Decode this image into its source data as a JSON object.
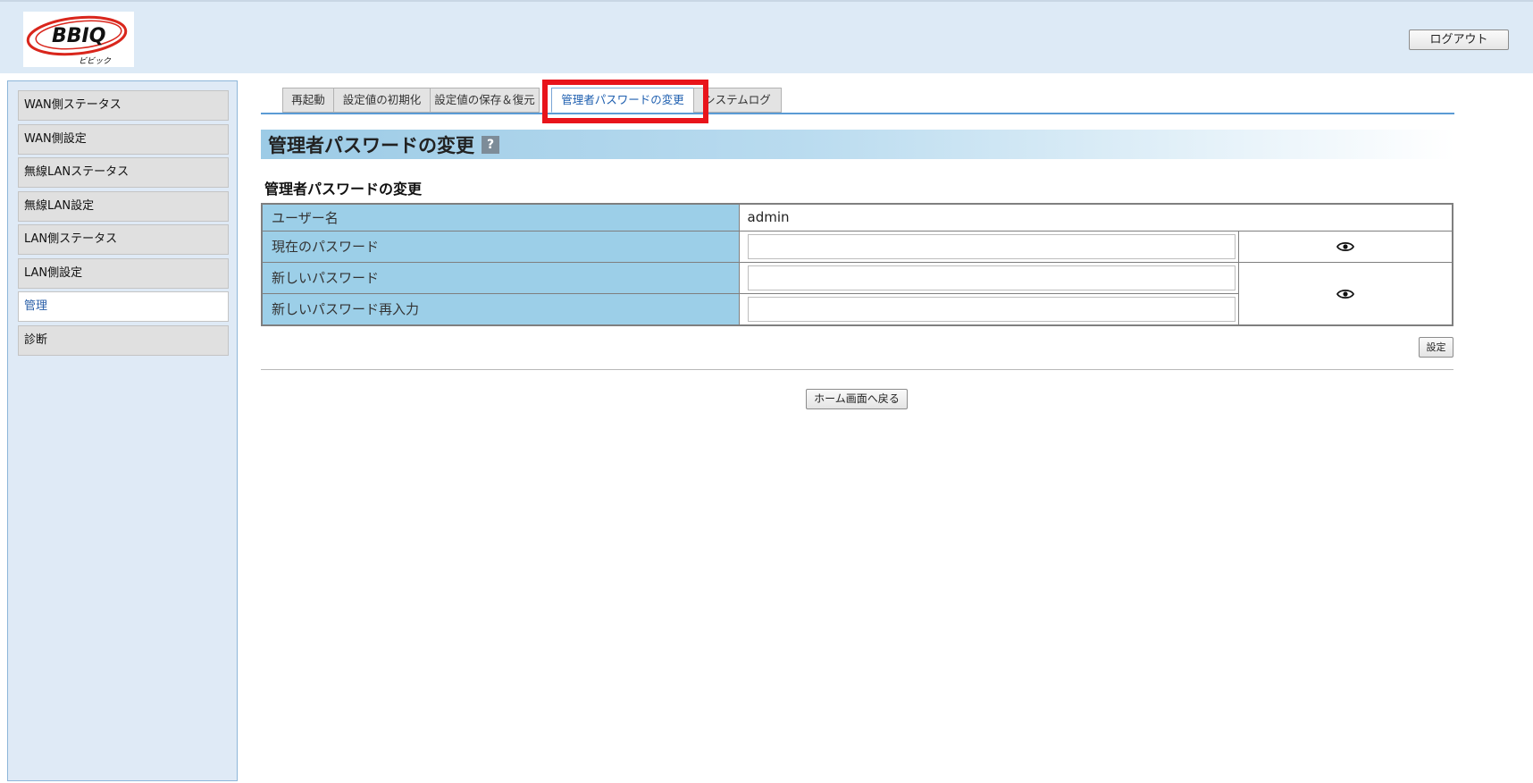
{
  "header": {
    "logo_text": "BBIQ",
    "logo_sub": "ビビック",
    "logout_label": "ログアウト"
  },
  "sidebar": {
    "items": [
      {
        "label": "WAN側ステータス"
      },
      {
        "label": "WAN側設定"
      },
      {
        "label": "無線LANステータス"
      },
      {
        "label": "無線LAN設定"
      },
      {
        "label": "LAN側ステータス"
      },
      {
        "label": "LAN側設定"
      },
      {
        "label": "管理",
        "active": true
      },
      {
        "label": "診断"
      }
    ]
  },
  "tabs": [
    {
      "label": "再起動"
    },
    {
      "label": "設定値の初期化"
    },
    {
      "label": "設定値の保存＆復元"
    },
    {
      "label": "管理者パスワードの変更",
      "active": true
    },
    {
      "label": "システムログ"
    }
  ],
  "page": {
    "heading": "管理者パスワードの変更",
    "help_glyph": "?",
    "section_title": "管理者パスワードの変更"
  },
  "form": {
    "username_label": "ユーザー名",
    "username_value": "admin",
    "current_password_label": "現在のパスワード",
    "current_password_value": "",
    "new_password_label": "新しいパスワード",
    "new_password_value": "",
    "confirm_password_label": "新しいパスワード再入力",
    "confirm_password_value": "",
    "set_label": "設定",
    "home_label": "ホーム画面へ戻る"
  },
  "colors": {
    "highlight": "#e8141b",
    "tab_accent": "#5b9bd5",
    "label_cell": "#9ccfe8",
    "sidebar_bg": "#dfeaf6",
    "header_bg": "#ddeaf6"
  },
  "icons": {
    "help": "help-icon",
    "eye": "eye-icon",
    "logo": "bbiq-logo-icon"
  }
}
